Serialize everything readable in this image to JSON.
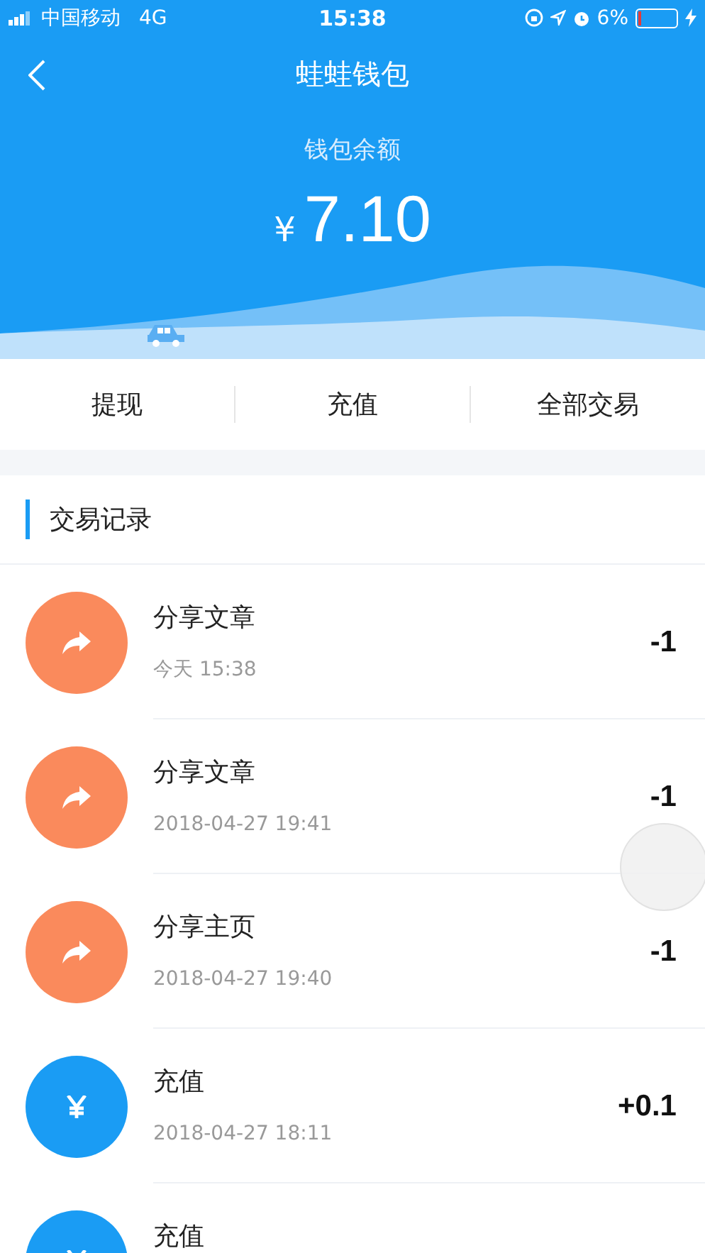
{
  "status_bar": {
    "carrier": "中国移动",
    "network": "4G",
    "time": "15:38",
    "battery": "6%"
  },
  "nav": {
    "title": "蛙蛙钱包"
  },
  "balance": {
    "label": "钱包余额",
    "currency": "¥",
    "amount": "7.10"
  },
  "actions": [
    "提现",
    "充值",
    "全部交易"
  ],
  "section": {
    "title": "交易记录"
  },
  "transactions": [
    {
      "kind": "share",
      "title": "分享文章",
      "time": "今天 15:38",
      "amount": "-1"
    },
    {
      "kind": "share",
      "title": "分享文章",
      "time": "2018-04-27 19:41",
      "amount": "-1"
    },
    {
      "kind": "share",
      "title": "分享主页",
      "time": "2018-04-27 19:40",
      "amount": "-1"
    },
    {
      "kind": "recharge",
      "title": "充值",
      "time": "2018-04-27 18:11",
      "amount": "+0.1"
    },
    {
      "kind": "recharge",
      "title": "充值"
    }
  ]
}
